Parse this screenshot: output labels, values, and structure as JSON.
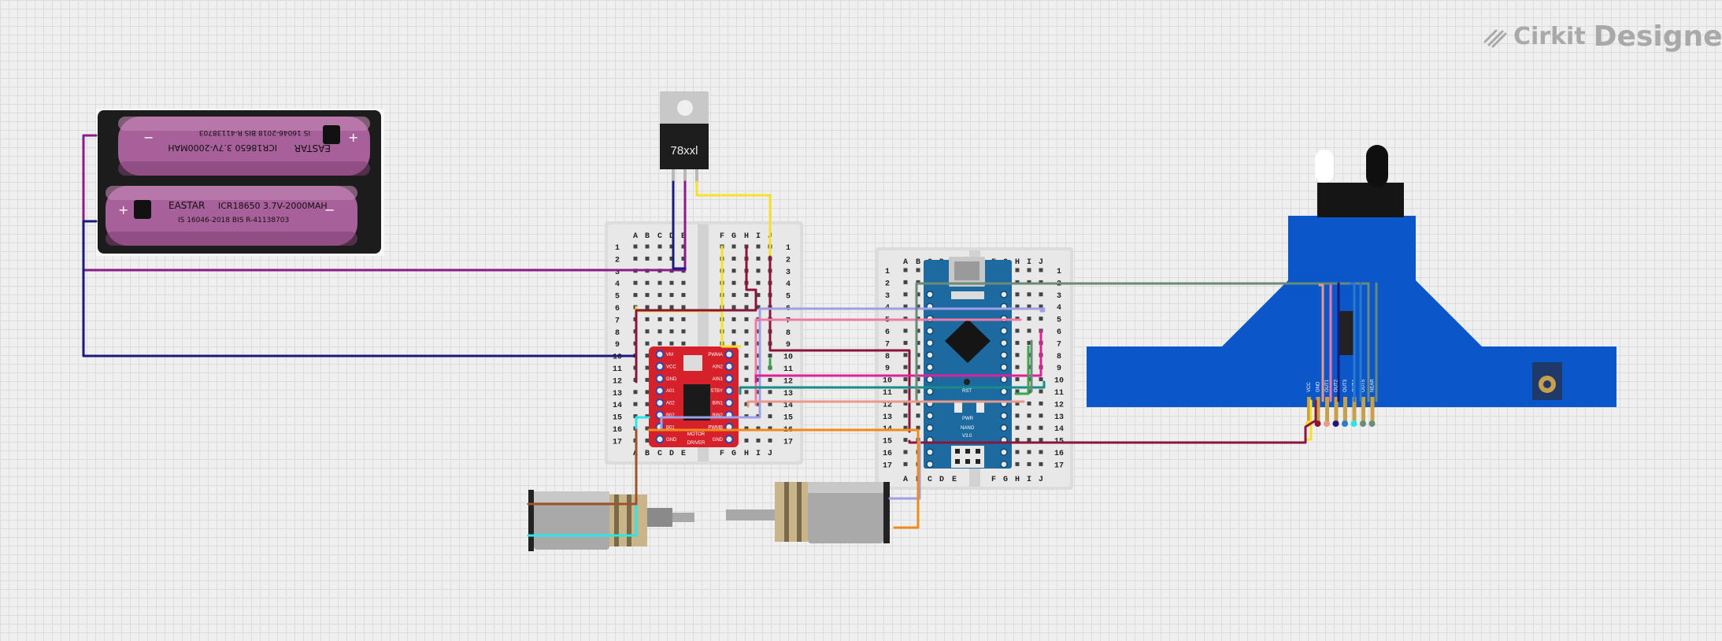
{
  "brand": {
    "name": "Cirkit",
    "product": "Designer",
    "icon": "cirkit-logo-icon"
  },
  "battery": {
    "cell_top": {
      "brand": "EASTAR",
      "line1": "ICR18650 3.7V-2000MAH",
      "line2": "IS 16046-2018 BIS R-41138703"
    },
    "cell_bottom": {
      "brand": "EASTAR",
      "line1": "ICR18650 3.7V-2000MAH",
      "line2": "IS 16046-2018 BIS R-41138703"
    },
    "plus": "+",
    "minus": "−"
  },
  "regulator": {
    "label": "78xxl"
  },
  "breadboard_left": {
    "columns_left": [
      "A",
      "B",
      "C",
      "D",
      "E"
    ],
    "columns_right": [
      "F",
      "G",
      "H",
      "I",
      "J"
    ],
    "rows": [
      "1",
      "2",
      "3",
      "4",
      "5",
      "6",
      "7",
      "8",
      "9",
      "10",
      "11",
      "12",
      "13",
      "14",
      "15",
      "16",
      "17"
    ]
  },
  "breadboard_right": {
    "columns_left": [
      "A",
      "B",
      "C",
      "D",
      "E"
    ],
    "columns_right": [
      "F",
      "G",
      "H",
      "I",
      "J"
    ],
    "rows": [
      "1",
      "2",
      "3",
      "4",
      "5",
      "6",
      "7",
      "8",
      "9",
      "10",
      "11",
      "12",
      "13",
      "14",
      "15",
      "16",
      "17"
    ]
  },
  "motor_driver": {
    "title_line1": "MOTOR",
    "title_line2": "DRIVER",
    "pins_left": [
      "VM",
      "VCC",
      "GND",
      "A01",
      "A02",
      "B02",
      "B01",
      "GND"
    ],
    "pins_right": [
      "PWMA",
      "AIN2",
      "AIN1",
      "STBY",
      "BIN1",
      "BIN2",
      "PWMB",
      "GND"
    ]
  },
  "arduino": {
    "board_label": "NANO",
    "version": "V3.0",
    "rst": "RST",
    "pwr": "PWR"
  },
  "sensor": {
    "pins": [
      "VCC",
      "GND",
      "OUT1",
      "OUT2",
      "OUT3",
      "OUT4",
      "OUT5",
      "NEAR"
    ]
  },
  "colors": {
    "navy": "#1a1a7a",
    "purple": "#8b1a8b",
    "yellow": "#f5e02a",
    "maroon": "#8a1538",
    "lavender": "#9f9fe6",
    "pink": "#f07aa6",
    "magenta": "#e0209a",
    "teal": "#1a8a8a",
    "cyan": "#2ae6e6",
    "orange": "#f08a1a",
    "green": "#3aa64a",
    "gray_green": "#6a8a7a",
    "blue": "#2a7ad0",
    "brown": "#a0522d",
    "salmon": "#e89a8a",
    "sensor_blue": "#0b56c8",
    "arduino_blue": "#1c6aa0",
    "driver_red": "#d6202a"
  }
}
